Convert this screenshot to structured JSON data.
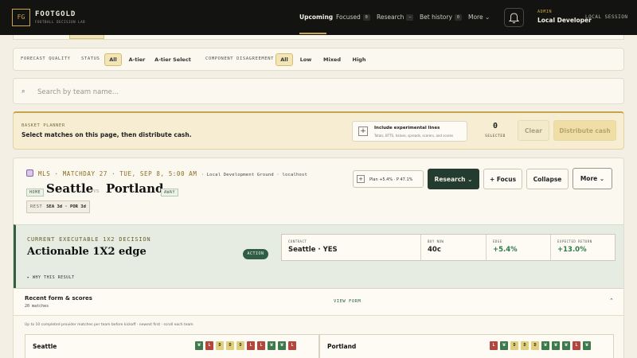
{
  "header": {
    "logo_initials": "FG",
    "brand": "FOOTGOLD",
    "brand_sub": "FOOTBALL DECISION LAB",
    "nav": [
      {
        "label": "Upcoming",
        "badge": null
      },
      {
        "label": "Focused",
        "badge": "0"
      },
      {
        "label": "Research",
        "badge": "—"
      },
      {
        "label": "Bet history",
        "badge": "0"
      },
      {
        "label": "More",
        "badge": null
      }
    ],
    "more_chevron": "⌄",
    "role": "ADMIN",
    "user": "Local Developer",
    "session": "LOCAL SESSION"
  },
  "filters": {
    "forecast_quality_label": "FORECAST QUALITY",
    "status_label": "STATUS",
    "status_options": [
      "All",
      "A-tier",
      "A-tier Select"
    ],
    "status_selected": "All",
    "disagreement_label": "COMPONENT DISAGREEMENT",
    "disagreement_options": [
      "All",
      "Low",
      "Mixed",
      "High"
    ],
    "disagreement_selected": "All"
  },
  "search": {
    "placeholder": "Search by team name...",
    "value": ""
  },
  "basket": {
    "label": "BASKET PLANNER",
    "text": "Select matches on this page, then distribute cash.",
    "experimental_title": "Include experimental lines",
    "experimental_sub": "Totals, BTTS, halves, spreads, scorers, and scores",
    "selected_count": "0",
    "selected_label": "SELECTED",
    "clear_label": "Clear",
    "distribute_label": "Distribute cash"
  },
  "match": {
    "meta": "MLS · MATCHDAY 27 · TUE, SEP 8, 5:00 AM",
    "venue": "· Local Development Ground · localhost",
    "home_tag": "HOME",
    "home_team": "Seattle",
    "vs": "vs",
    "away_team": "Portland",
    "away_tag": "AWAY",
    "rest_label": "REST",
    "rest_value": "SEA 3d · POR 3d",
    "plan_text": "Plan +5.4% · P 47.1%",
    "research_label": "Research",
    "focus_label": "+ Focus",
    "collapse_label": "Collapse",
    "more_label": "More",
    "chevron": "⌄"
  },
  "decision": {
    "label": "CURRENT EXECUTABLE 1X2 DECISION",
    "title": "Actionable 1X2 edge",
    "badge": "ACTION",
    "metrics": [
      {
        "label": "CONTRACT",
        "value": "Seattle · YES",
        "green": false
      },
      {
        "label": "BUY NOW",
        "value": "40c",
        "green": false
      },
      {
        "label": "EDGE",
        "value": "+5.4%",
        "green": true
      },
      {
        "label": "EXPECTED RETURN",
        "value": "+13.0%",
        "green": true
      }
    ],
    "why": "▸ WHY THIS RESULT"
  },
  "recent_form": {
    "title": "Recent form & scores",
    "subtitle": "20 matches",
    "view_label": "VIEW FORM",
    "collapse_icon": "⌃",
    "note": "Up to 10 completed provider matches per team before kickoff · newest first · scroll each team",
    "teams": [
      {
        "name": "Seattle",
        "results": [
          "W",
          "L",
          "D",
          "D",
          "D",
          "L",
          "L",
          "W",
          "W",
          "L"
        ]
      },
      {
        "name": "Portland",
        "results": [
          "L",
          "W",
          "D",
          "D",
          "D",
          "W",
          "W",
          "W",
          "L",
          "W"
        ]
      }
    ]
  },
  "colors": {
    "header_bg": "#131311",
    "accent_gold": "#c9a54a",
    "action_green": "#2f5e44",
    "win": "#3f7a4d",
    "draw": "#e0cf7c",
    "loss": "#b4473d"
  }
}
